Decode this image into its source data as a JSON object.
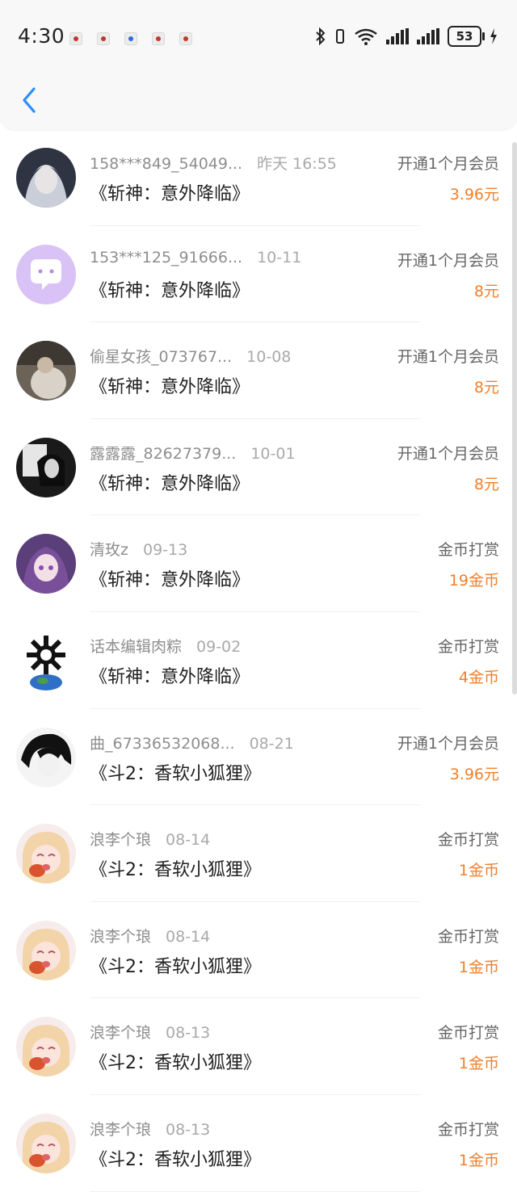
{
  "status": {
    "time": "4:30",
    "battery": "53",
    "net_badge": "6"
  },
  "colors": {
    "accent": "#2c8ef8",
    "amount": "#f0802a"
  },
  "items": [
    {
      "name": "158***849_54049...",
      "date": "昨天 16:55",
      "book": "《斩神：意外降临》",
      "type": "开通1个月会员",
      "amount": "3.96元",
      "avatar": "silver-hair"
    },
    {
      "name": "153***125_91666...",
      "date": "10-11",
      "book": "《斩神：意外降临》",
      "type": "开通1个月会员",
      "amount": "8元",
      "avatar": "chat-bubble"
    },
    {
      "name": "偷星女孩_073767...",
      "date": "10-08",
      "book": "《斩神：意外降临》",
      "type": "开通1个月会员",
      "amount": "8元",
      "avatar": "photo-girl"
    },
    {
      "name": "露露露_82627379...",
      "date": "10-01",
      "book": "《斩神：意外降临》",
      "type": "开通1个月会员",
      "amount": "8元",
      "avatar": "bw-selfie"
    },
    {
      "name": "清玫z",
      "date": "09-13",
      "book": "《斩神：意外降临》",
      "type": "金币打赏",
      "amount": "19金币",
      "avatar": "purple-anime"
    },
    {
      "name": "话本编辑肉粽",
      "date": "09-02",
      "book": "《斩神：意外降临》",
      "type": "金币打赏",
      "amount": "4金币",
      "avatar": "skull-globe"
    },
    {
      "name": "曲_67336532068...",
      "date": "08-21",
      "book": "《斗2：香软小狐狸》",
      "type": "开通1个月会员",
      "amount": "3.96元",
      "avatar": "bw-anime"
    },
    {
      "name": "浪李个琅",
      "date": "08-14",
      "book": "《斗2：香软小狐狸》",
      "type": "金币打赏",
      "amount": "1金币",
      "avatar": "pink-anime"
    },
    {
      "name": "浪李个琅",
      "date": "08-14",
      "book": "《斗2：香软小狐狸》",
      "type": "金币打赏",
      "amount": "1金币",
      "avatar": "pink-anime"
    },
    {
      "name": "浪李个琅",
      "date": "08-13",
      "book": "《斗2：香软小狐狸》",
      "type": "金币打赏",
      "amount": "1金币",
      "avatar": "pink-anime"
    },
    {
      "name": "浪李个琅",
      "date": "08-13",
      "book": "《斗2：香软小狐狸》",
      "type": "金币打赏",
      "amount": "1金币",
      "avatar": "pink-anime"
    }
  ]
}
